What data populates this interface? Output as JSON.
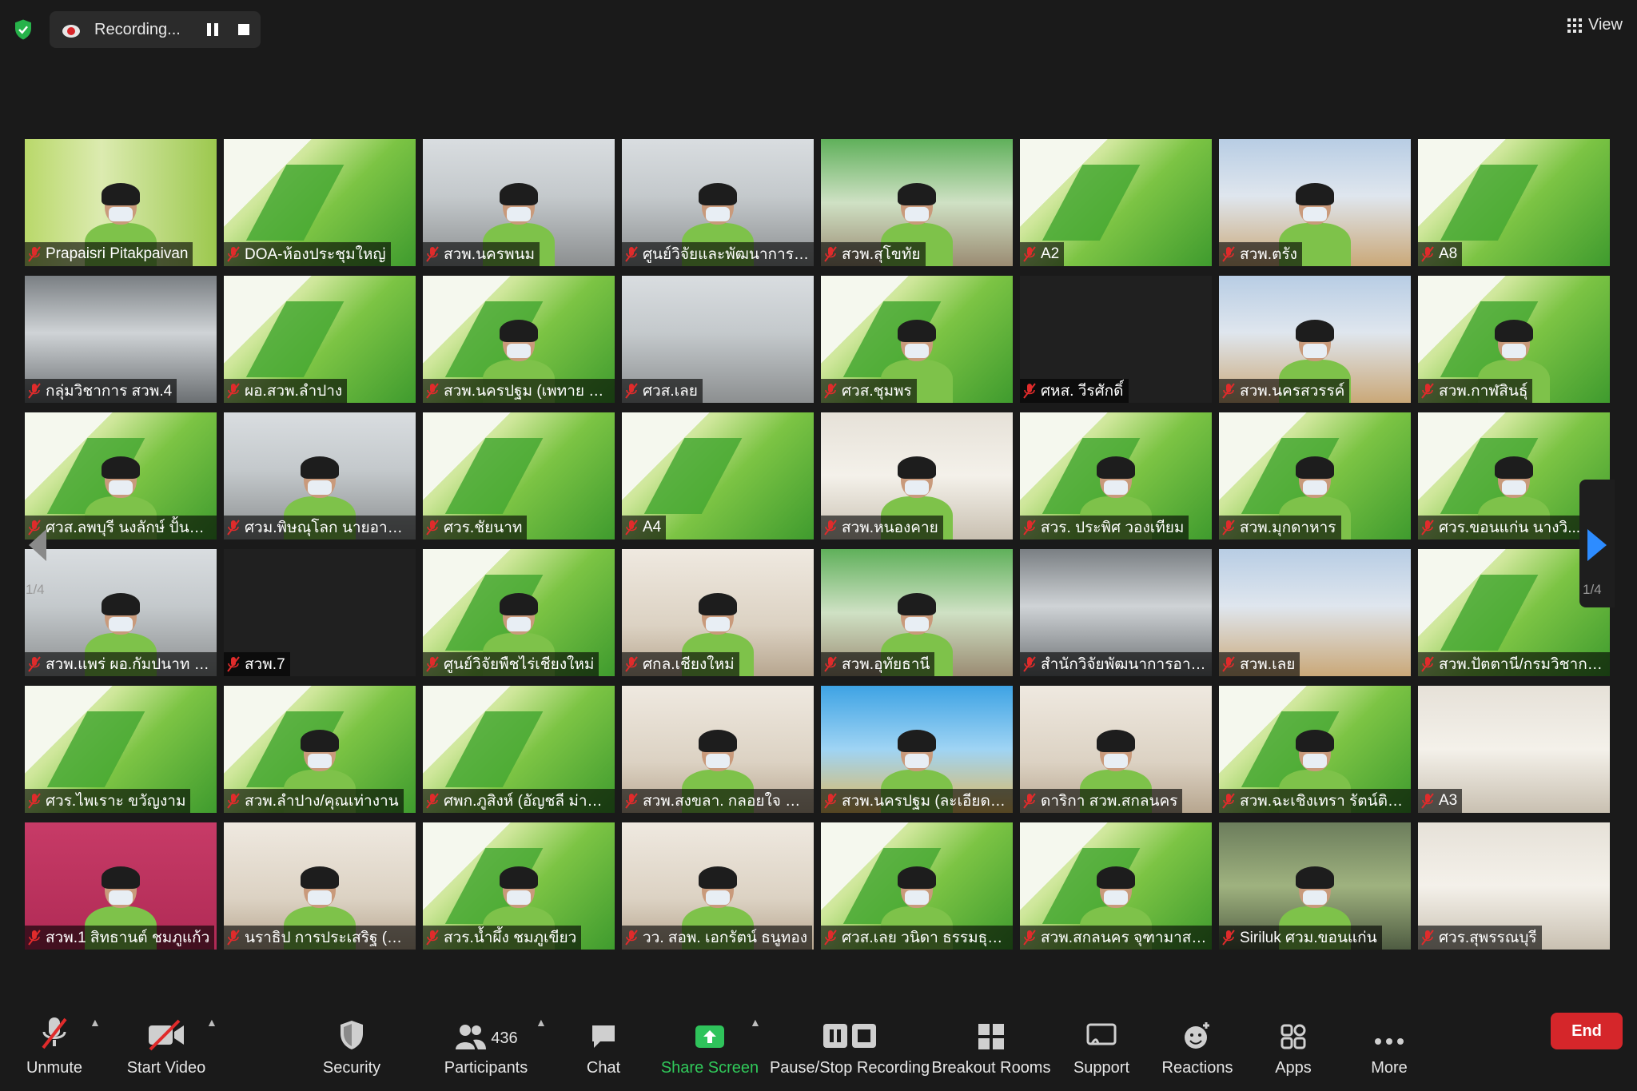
{
  "recording": {
    "text": "Recording..."
  },
  "view": {
    "label": "View"
  },
  "navigation": {
    "page_indicator": "1/4"
  },
  "tiles": [
    {
      "name": "Prapaisri Pitakpaivan",
      "bg": "grass",
      "person": true
    },
    {
      "name": "DOA-ห้องประชุมใหญ่",
      "bg": "slide",
      "active": true
    },
    {
      "name": "สวพ.นครพนม",
      "bg": "room",
      "person": true
    },
    {
      "name": "ศูนย์วิจัยและพัฒนาการเก...",
      "bg": "room",
      "person": true
    },
    {
      "name": "สวพ.สุโขทัย",
      "bg": "room-green",
      "person": true
    },
    {
      "name": "A2",
      "bg": "slide"
    },
    {
      "name": "สวพ.ตรัง",
      "bg": "room-blue",
      "person": true
    },
    {
      "name": "A8",
      "bg": "slide"
    },
    {
      "name": "กลุ่มวิชาการ สวพ.4",
      "bg": "window"
    },
    {
      "name": "ผอ.สวพ.ลำปาง",
      "bg": "slide"
    },
    {
      "name": "สวพ.นครปฐม (เพทาย กา...",
      "bg": "slide",
      "person": true
    },
    {
      "name": "ศวส.เลย",
      "bg": "room"
    },
    {
      "name": "ศวส.ชุมพร",
      "bg": "slide",
      "person": true
    },
    {
      "name": "ศหส. วีรศักดิ์",
      "bg": "dark"
    },
    {
      "name": "สวพ.นครสวรรค์",
      "bg": "room-blue",
      "person": true
    },
    {
      "name": "สวพ.กาฬสินธุ์",
      "bg": "slide",
      "person": true
    },
    {
      "name": "ศวส.ลพบุรี นงลักษ์ ปั้นลาย",
      "bg": "slide",
      "person": true
    },
    {
      "name": "ศวม.พิษณุโลก นายอานน...",
      "bg": "room",
      "person": true
    },
    {
      "name": "ศวร.ชัยนาท",
      "bg": "slide"
    },
    {
      "name": "A4",
      "bg": "slide"
    },
    {
      "name": "สวพ.หนองคาย",
      "bg": "hall",
      "person": true
    },
    {
      "name": "สวร. ประพิศ วองเทียม",
      "bg": "slide",
      "person": true
    },
    {
      "name": "สวพ.มุกดาหาร",
      "bg": "slide",
      "person": true
    },
    {
      "name": "ศวร.ขอนแก่น นางวิ...",
      "bg": "slide",
      "person": true
    },
    {
      "name": "สวพ.แพร่ ผอ.กัมปนาท บุ...",
      "bg": "room",
      "person": true
    },
    {
      "name": "สวพ.7",
      "bg": "dark"
    },
    {
      "name": "ศูนย์วิจัยพืชไร่เชียงใหม่",
      "bg": "slide",
      "person": true
    },
    {
      "name": "ศกล.เชียงใหม่",
      "bg": "office",
      "person": true
    },
    {
      "name": "สวพ.อุทัยธานี",
      "bg": "room-green",
      "person": true
    },
    {
      "name": "สำนักวิจัยพัฒนาการอารั...",
      "bg": "window"
    },
    {
      "name": "สวพ.เลย",
      "bg": "room-blue"
    },
    {
      "name": "สวพ.ปัตตานี/กรมวิชาการ...",
      "bg": "slide"
    },
    {
      "name": "ศวร.ไพเราะ ขวัญงาม",
      "bg": "slide"
    },
    {
      "name": "สวพ.ลำปาง/คุณเท่างาน",
      "bg": "slide",
      "person": true
    },
    {
      "name": "ศพก.ภูสิงห์ (อัญชลี ม่าน...",
      "bg": "slide"
    },
    {
      "name": "สวพ.สงขลา. กลอยใจ คงจิ...",
      "bg": "office",
      "person": true
    },
    {
      "name": "สวพ.นครปฐม (ละเอียด ปั้...",
      "bg": "temple",
      "person": true
    },
    {
      "name": "ดาริกา สวพ.สกลนคร",
      "bg": "office",
      "person": true
    },
    {
      "name": "สวพ.ฉะเชิงเทรา รัตน์ติยา ...",
      "bg": "slide",
      "person": true
    },
    {
      "name": "A3",
      "bg": "hall"
    },
    {
      "name": "สวพ.1 สิทธานต์ ชมภูแก้ว",
      "bg": "pink",
      "person": true
    },
    {
      "name": "นราธิป การประเสริฐ (กผ...",
      "bg": "office",
      "person": true
    },
    {
      "name": "สวร.น้ำผึ้ง ชมภูเขียว",
      "bg": "slide",
      "person": true
    },
    {
      "name": "วว. สอพ. เอกรัตน์ ธนูทอง",
      "bg": "office",
      "person": true
    },
    {
      "name": "ศวส.เลย วนิดา ธรรมธุระส...",
      "bg": "slide",
      "person": true
    },
    {
      "name": "สวพ.สกลนคร จุฑามาส ส...",
      "bg": "slide",
      "person": true
    },
    {
      "name": "Siriluk ศวม.ขอนแก่น",
      "bg": "garden",
      "person": true
    },
    {
      "name": "ศวร.สุพรรณบุรี",
      "bg": "hall"
    }
  ],
  "toolbar": {
    "unmute": "Unmute",
    "start_video": "Start Video",
    "security": "Security",
    "participants": "Participants",
    "participants_count": "436",
    "chat": "Chat",
    "share_screen": "Share Screen",
    "pause_stop_recording": "Pause/Stop Recording",
    "breakout_rooms": "Breakout Rooms",
    "support": "Support",
    "reactions": "Reactions",
    "apps": "Apps",
    "more": "More",
    "end": "End"
  }
}
